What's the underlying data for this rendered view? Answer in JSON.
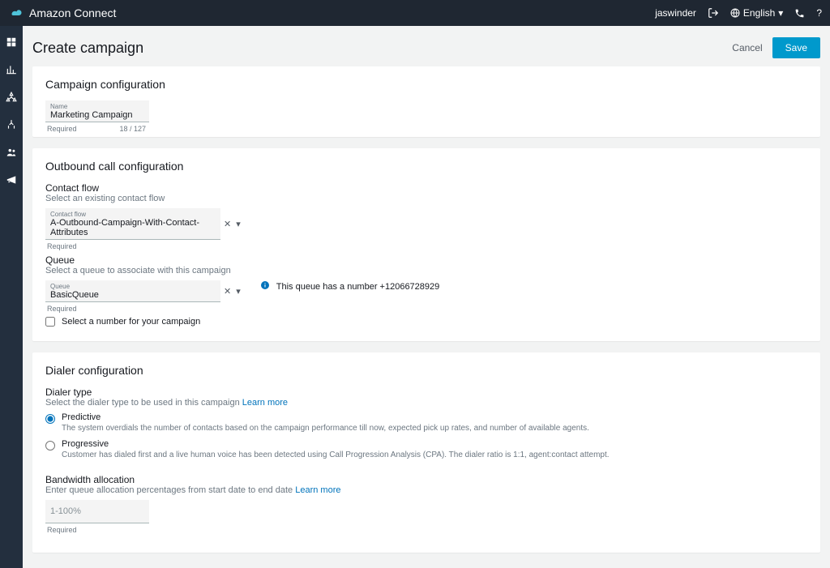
{
  "header": {
    "brand": "Amazon Connect",
    "user": "jaswinder",
    "language": "English"
  },
  "page": {
    "title": "Create campaign",
    "cancel": "Cancel",
    "save": "Save"
  },
  "campaign_config": {
    "title": "Campaign configuration",
    "name_label": "Name",
    "name_value": "Marketing Campaign",
    "name_counter": "18 / 127",
    "required": "Required"
  },
  "outbound": {
    "title": "Outbound call configuration",
    "contact_flow": {
      "label": "Contact flow",
      "help": "Select an existing contact flow",
      "field_label": "Contact flow",
      "value": "A-Outbound-Campaign-With-Contact-Attributes",
      "required": "Required"
    },
    "queue": {
      "label": "Queue",
      "help": "Select a queue to associate with this campaign",
      "field_label": "Queue",
      "value": "BasicQueue",
      "required": "Required",
      "info": "This queue has a number +12066728929"
    },
    "checkbox": "Select a number for your campaign"
  },
  "dialer": {
    "title": "Dialer configuration",
    "type_label": "Dialer type",
    "type_help": "Select the dialer type to be used in this campaign",
    "learn_more": "Learn more",
    "options": [
      {
        "name": "Predictive",
        "desc": "The system overdials the number of contacts based on the campaign performance till now, expected pick up rates, and number of available agents.",
        "checked": true
      },
      {
        "name": "Progressive",
        "desc": "Customer has dialed first and a live human voice has been detected using Call Progression Analysis (CPA). The dialer ratio is 1:1, agent:contact attempt.",
        "checked": false
      }
    ],
    "bandwidth": {
      "label": "Bandwidth allocation",
      "help": "Enter queue allocation percentages from start date to end date",
      "placeholder": "1-100%",
      "required": "Required"
    }
  }
}
